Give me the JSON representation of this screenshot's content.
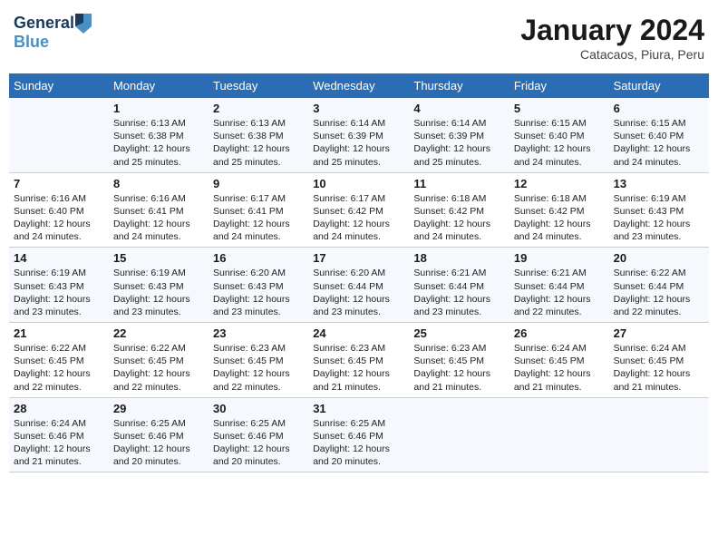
{
  "logo": {
    "line1": "General",
    "line2": "Blue"
  },
  "title": "January 2024",
  "subtitle": "Catacaos, Piura, Peru",
  "days_header": [
    "Sunday",
    "Monday",
    "Tuesday",
    "Wednesday",
    "Thursday",
    "Friday",
    "Saturday"
  ],
  "weeks": [
    [
      {
        "num": "",
        "text": ""
      },
      {
        "num": "1",
        "text": "Sunrise: 6:13 AM\nSunset: 6:38 PM\nDaylight: 12 hours\nand 25 minutes."
      },
      {
        "num": "2",
        "text": "Sunrise: 6:13 AM\nSunset: 6:38 PM\nDaylight: 12 hours\nand 25 minutes."
      },
      {
        "num": "3",
        "text": "Sunrise: 6:14 AM\nSunset: 6:39 PM\nDaylight: 12 hours\nand 25 minutes."
      },
      {
        "num": "4",
        "text": "Sunrise: 6:14 AM\nSunset: 6:39 PM\nDaylight: 12 hours\nand 25 minutes."
      },
      {
        "num": "5",
        "text": "Sunrise: 6:15 AM\nSunset: 6:40 PM\nDaylight: 12 hours\nand 24 minutes."
      },
      {
        "num": "6",
        "text": "Sunrise: 6:15 AM\nSunset: 6:40 PM\nDaylight: 12 hours\nand 24 minutes."
      }
    ],
    [
      {
        "num": "7",
        "text": "Sunrise: 6:16 AM\nSunset: 6:40 PM\nDaylight: 12 hours\nand 24 minutes."
      },
      {
        "num": "8",
        "text": "Sunrise: 6:16 AM\nSunset: 6:41 PM\nDaylight: 12 hours\nand 24 minutes."
      },
      {
        "num": "9",
        "text": "Sunrise: 6:17 AM\nSunset: 6:41 PM\nDaylight: 12 hours\nand 24 minutes."
      },
      {
        "num": "10",
        "text": "Sunrise: 6:17 AM\nSunset: 6:42 PM\nDaylight: 12 hours\nand 24 minutes."
      },
      {
        "num": "11",
        "text": "Sunrise: 6:18 AM\nSunset: 6:42 PM\nDaylight: 12 hours\nand 24 minutes."
      },
      {
        "num": "12",
        "text": "Sunrise: 6:18 AM\nSunset: 6:42 PM\nDaylight: 12 hours\nand 24 minutes."
      },
      {
        "num": "13",
        "text": "Sunrise: 6:19 AM\nSunset: 6:43 PM\nDaylight: 12 hours\nand 23 minutes."
      }
    ],
    [
      {
        "num": "14",
        "text": "Sunrise: 6:19 AM\nSunset: 6:43 PM\nDaylight: 12 hours\nand 23 minutes."
      },
      {
        "num": "15",
        "text": "Sunrise: 6:19 AM\nSunset: 6:43 PM\nDaylight: 12 hours\nand 23 minutes."
      },
      {
        "num": "16",
        "text": "Sunrise: 6:20 AM\nSunset: 6:43 PM\nDaylight: 12 hours\nand 23 minutes."
      },
      {
        "num": "17",
        "text": "Sunrise: 6:20 AM\nSunset: 6:44 PM\nDaylight: 12 hours\nand 23 minutes."
      },
      {
        "num": "18",
        "text": "Sunrise: 6:21 AM\nSunset: 6:44 PM\nDaylight: 12 hours\nand 23 minutes."
      },
      {
        "num": "19",
        "text": "Sunrise: 6:21 AM\nSunset: 6:44 PM\nDaylight: 12 hours\nand 22 minutes."
      },
      {
        "num": "20",
        "text": "Sunrise: 6:22 AM\nSunset: 6:44 PM\nDaylight: 12 hours\nand 22 minutes."
      }
    ],
    [
      {
        "num": "21",
        "text": "Sunrise: 6:22 AM\nSunset: 6:45 PM\nDaylight: 12 hours\nand 22 minutes."
      },
      {
        "num": "22",
        "text": "Sunrise: 6:22 AM\nSunset: 6:45 PM\nDaylight: 12 hours\nand 22 minutes."
      },
      {
        "num": "23",
        "text": "Sunrise: 6:23 AM\nSunset: 6:45 PM\nDaylight: 12 hours\nand 22 minutes."
      },
      {
        "num": "24",
        "text": "Sunrise: 6:23 AM\nSunset: 6:45 PM\nDaylight: 12 hours\nand 21 minutes."
      },
      {
        "num": "25",
        "text": "Sunrise: 6:23 AM\nSunset: 6:45 PM\nDaylight: 12 hours\nand 21 minutes."
      },
      {
        "num": "26",
        "text": "Sunrise: 6:24 AM\nSunset: 6:45 PM\nDaylight: 12 hours\nand 21 minutes."
      },
      {
        "num": "27",
        "text": "Sunrise: 6:24 AM\nSunset: 6:45 PM\nDaylight: 12 hours\nand 21 minutes."
      }
    ],
    [
      {
        "num": "28",
        "text": "Sunrise: 6:24 AM\nSunset: 6:46 PM\nDaylight: 12 hours\nand 21 minutes."
      },
      {
        "num": "29",
        "text": "Sunrise: 6:25 AM\nSunset: 6:46 PM\nDaylight: 12 hours\nand 20 minutes."
      },
      {
        "num": "30",
        "text": "Sunrise: 6:25 AM\nSunset: 6:46 PM\nDaylight: 12 hours\nand 20 minutes."
      },
      {
        "num": "31",
        "text": "Sunrise: 6:25 AM\nSunset: 6:46 PM\nDaylight: 12 hours\nand 20 minutes."
      },
      {
        "num": "",
        "text": ""
      },
      {
        "num": "",
        "text": ""
      },
      {
        "num": "",
        "text": ""
      }
    ]
  ]
}
